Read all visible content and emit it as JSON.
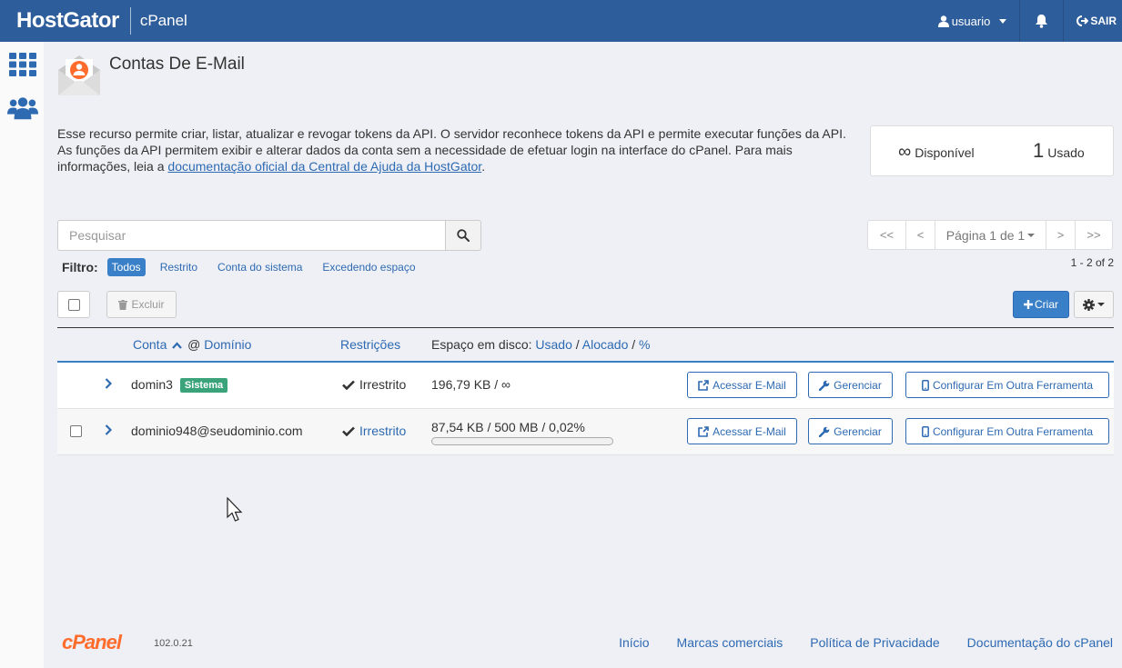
{
  "topbar": {
    "brand": "HostGator",
    "product": "cPanel",
    "user": "usuario",
    "logout": "SAIR"
  },
  "page": {
    "title": "Contas De E-Mail",
    "description_text": "Esse recurso permite criar, listar, atualizar e revogar tokens da API. O servidor reconhece tokens da API e permite executar funções da API. As funções da API permitem exibir e alterar dados da conta sem a necessidade de efetuar login na interface do cPanel. Para mais informações, leia a ",
    "description_link": "documentação oficial da Central de Ajuda da HostGator",
    "description_end": "."
  },
  "stats": {
    "available_value": "∞",
    "available_label": "Disponível",
    "used_value": "1",
    "used_label": "Usado"
  },
  "search": {
    "placeholder": "Pesquisar"
  },
  "pagination": {
    "first": "<<",
    "prev": "<",
    "page_label": "Página 1 de 1",
    "next": ">",
    "last": ">>",
    "count": "1 - 2 of 2"
  },
  "filter": {
    "label": "Filtro:",
    "items": [
      "Todos",
      "Restrito",
      "Conta do sistema",
      "Excedendo espaço"
    ]
  },
  "toolbar": {
    "delete_label": "Excluir",
    "create_label": "Criar"
  },
  "table": {
    "col_account": "Conta",
    "col_at": "@",
    "col_domain": "Domínio",
    "col_restrictions": "Restrições",
    "col_disk_label": "Espaço em disco:",
    "col_disk_used": "Usado",
    "col_disk_sep": "/",
    "col_disk_alloc": "Alocado",
    "col_disk_pct": "%",
    "rows": [
      {
        "account": "domin3",
        "badge": "Sistema",
        "restriction": "Irrestrito",
        "disk": "196,79 KB / ∞",
        "btn_access": "Acessar E-Mail",
        "btn_manage": "Gerenciar",
        "btn_config": "Configurar Em Outra Ferramenta"
      },
      {
        "account": "dominio948@seudominio.com",
        "restriction": "Irrestrito",
        "disk": "87,54 KB / 500 MB / 0,02%",
        "disk_usage_percent": 0.02,
        "btn_access": "Acessar E-Mail",
        "btn_manage": "Gerenciar",
        "btn_config": "Configurar Em Outra Ferramenta"
      }
    ]
  },
  "footer": {
    "logo": "cPanel",
    "version": "102.0.21",
    "links": [
      "Início",
      "Marcas comerciais",
      "Política de Privacidade",
      "Documentação do cPanel"
    ]
  },
  "colors": {
    "topbar": "#2e5d9b",
    "accent": "#3a80c8",
    "badge": "#3aa37a",
    "cpanel_orange": "#ff6c2c"
  }
}
